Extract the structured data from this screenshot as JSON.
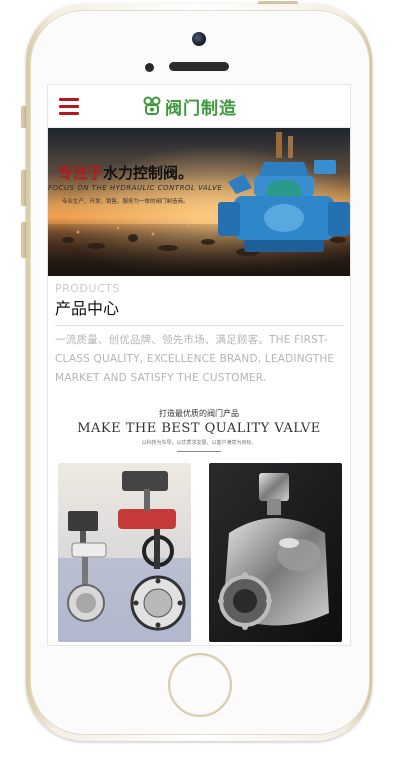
{
  "header": {
    "logo_text": "阀门制造",
    "icons": [
      "hamburger-menu-icon",
      "logo-icon"
    ],
    "accent_color": "#b3181e",
    "logo_color": "#3a9a3a"
  },
  "banner": {
    "title_red": "专注于",
    "title_black": "水力控制阀。",
    "subtitle_en": "FOCUS ON THE HYDRAULIC CONTROL VALVE",
    "subtitle_cn": "专业生产、开发、销售、服务为一体的阀门制造商。"
  },
  "products_section": {
    "label_en": "PRODUCTS",
    "label_cn": "产品中心",
    "description": "一流质量、创优品牌、领先市场、满足顾客。THE FIRST-CLASS QUALITY, EXCELLENCE BRAND, LEADINGTHE MARKET AND SATISFY THE CUSTOMER.",
    "slogan_cn": "打造最优质的阀门产品",
    "slogan_en": "MAKE THE BEST QUALITY VALVE",
    "slogan_small": "以科技为先导，以优质求发展，以客户满意为目标。"
  }
}
